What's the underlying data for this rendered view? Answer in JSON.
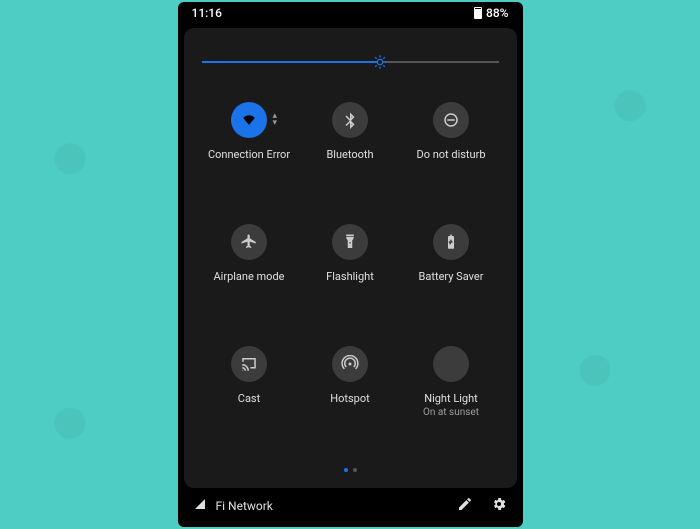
{
  "status_bar": {
    "time": "11:16",
    "battery_percent": "88%"
  },
  "brightness": {
    "value_percent": 60
  },
  "tiles": [
    {
      "id": "wifi",
      "label": "Connection Error",
      "active": true
    },
    {
      "id": "bluetooth",
      "label": "Bluetooth",
      "active": false
    },
    {
      "id": "dnd",
      "label": "Do not disturb",
      "active": false
    },
    {
      "id": "airplane",
      "label": "Airplane mode",
      "active": false
    },
    {
      "id": "flashlight",
      "label": "Flashlight",
      "active": false
    },
    {
      "id": "battery_saver",
      "label": "Battery Saver",
      "active": false
    },
    {
      "id": "cast",
      "label": "Cast",
      "active": false
    },
    {
      "id": "hotspot",
      "label": "Hotspot",
      "active": false
    },
    {
      "id": "night_light",
      "label": "Night Light",
      "sublabel": "On at sunset",
      "active": false
    }
  ],
  "pager": {
    "pages": 2,
    "current": 0
  },
  "footer": {
    "carrier": "Fi Network"
  },
  "colors": {
    "accent": "#1a73e8",
    "panel_bg": "#1a1a1a",
    "tile_bg": "#3c3c3c"
  }
}
